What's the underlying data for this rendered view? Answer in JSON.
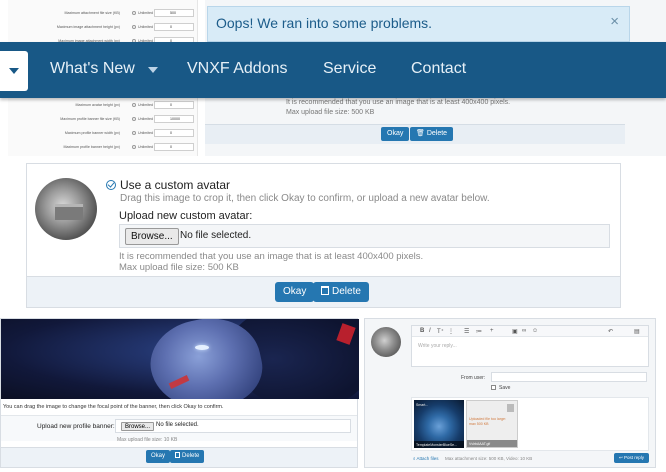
{
  "top_settings": {
    "rows": [
      {
        "label": "Maximum attachment file size (KB)",
        "option": "Unlimited",
        "value": "500"
      },
      {
        "label": "Maximum image attachment height (px)",
        "option": "Unlimited",
        "value": "0"
      },
      {
        "label": "Maximum image attachment width (px)",
        "option": "Unlimited",
        "value": "0"
      },
      {
        "label": "Maximum avatar height (px)",
        "option": "Unlimited",
        "value": "0"
      },
      {
        "label": "Maximum profile banner file size (KB)",
        "option": "Unlimited",
        "value": "10000"
      },
      {
        "label": "Maximum profile banner width (px)",
        "option": "Unlimited",
        "value": "0"
      },
      {
        "label": "Maximum profile banner height (px)",
        "option": "Unlimited",
        "value": "0"
      }
    ]
  },
  "error_overlay": {
    "title": "Oops! We ran into some problems.",
    "close": "×",
    "note_line1": "It is recommended that you use an image that is at least 400x400 pixels.",
    "note_line2": "Max upload file size: 500 KB",
    "okay_label": "Okay",
    "delete_label": "Delete"
  },
  "nav": {
    "items": [
      {
        "label": "What's New",
        "has_dropdown": true
      },
      {
        "label": "VNXF Addons"
      },
      {
        "label": "Service"
      },
      {
        "label": "Contact"
      }
    ],
    "color": "#185886"
  },
  "avatar_panel": {
    "option_label": "Use a custom avatar",
    "hint": "Drag this image to crop it, then click Okay to confirm, or upload a new avatar below.",
    "upload_label": "Upload new custom avatar:",
    "browse_label": "Browse...",
    "file_status": "No file selected.",
    "rec_line1": "It is recommended that you use an image that is at least 400x400 pixels.",
    "rec_line2": "Max upload file size: 500 KB",
    "okay_label": "Okay",
    "delete_label": "Delete"
  },
  "banner_panel": {
    "hint": "You can drag the image to change the focal point of the banner, then click Okay to confirm.",
    "upload_label": "Upload new profile banner:",
    "browse_label": "Browse...",
    "file_status": "No file selected.",
    "max_size": "Max upload file size: 10 KB",
    "okay_label": "Okay",
    "delete_label": "Delete"
  },
  "reply_panel": {
    "placeholder": "Write your reply...",
    "from_label": "From user:",
    "save_label": "Save",
    "thumb_label": "Smart...",
    "thumb_file": "TemplateMonsterBlueSe...",
    "error_text": "Uploaded file too large: max 500 KB",
    "error_file": "VvlrbAAAT.gif",
    "attach_label": "Attach files",
    "max_text": "Max attachment size: 500 KB, Video: 10 KB",
    "post_label": "Post reply",
    "accent": "#2577b1"
  }
}
